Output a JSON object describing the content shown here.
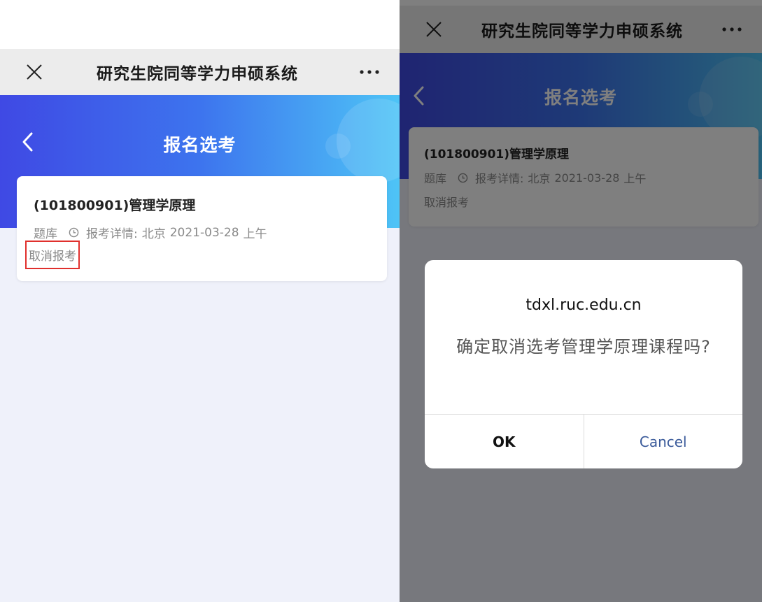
{
  "left_screen": {
    "titlebar": {
      "title": "研究生院同等学力申硕系统"
    },
    "header": {
      "title": "报名选考"
    },
    "card": {
      "course": "(101800901)管理学原理",
      "source": "题库",
      "detail_label": "报考详情:",
      "location": "北京",
      "date": "2021-03-28",
      "session": "上午",
      "cancel_label": "取消报考"
    }
  },
  "right_screen": {
    "titlebar": {
      "title": "研究生院同等学力申硕系统"
    },
    "header": {
      "title": "报名选考"
    },
    "card": {
      "course": "(101800901)管理学原理",
      "source": "题库",
      "detail_label": "报考详情:",
      "location": "北京",
      "date": "2021-03-28",
      "session": "上午",
      "cancel_label": "取消报考"
    },
    "dialog": {
      "domain": "tdxl.ruc.edu.cn",
      "message": "确定取消选考管理学原理课程吗?",
      "ok_label": "OK",
      "cancel_label": "Cancel"
    }
  },
  "icons": [
    "close-icon",
    "more-icon",
    "back-icon",
    "clock-icon"
  ],
  "colors": {
    "header_gradient_start": "#3f49e4",
    "header_gradient_end": "#4ec4f6",
    "highlight_border": "#e0302d",
    "dialog_cancel": "#3a5a9a"
  }
}
